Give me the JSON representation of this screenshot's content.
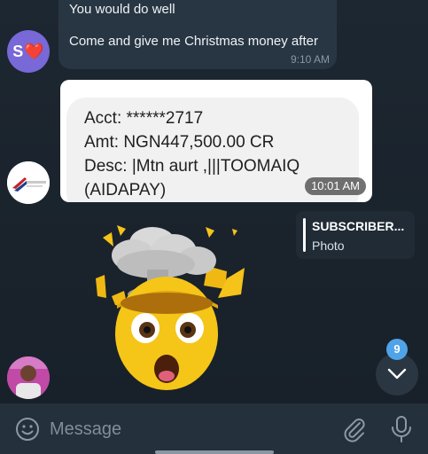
{
  "chat": {
    "message1": {
      "line1": "You would do well",
      "line2": "Come and give me Christmas money after",
      "time": "9:10 AM"
    },
    "avatar_s": {
      "letter": "S",
      "emoji": "❤️"
    },
    "image_message": {
      "lines": [
        "Acct: ******2717",
        "Amt: NGN447,500.00 CR",
        "Desc: |Mtn aurt ,|||TOOMAIQ",
        "(AIDAPAY)"
      ],
      "time": "10:01 AM"
    },
    "forwarded": {
      "title": "SUBSCRIBER...",
      "subtitle": "Photo"
    },
    "sticker": {
      "icon": "exploding-head-icon"
    },
    "unread_count": "9"
  },
  "input": {
    "placeholder": "Message"
  },
  "colors": {
    "background": "#1f2933",
    "accent": "#4fa3e8",
    "avatar_purple": "#7868d8"
  }
}
